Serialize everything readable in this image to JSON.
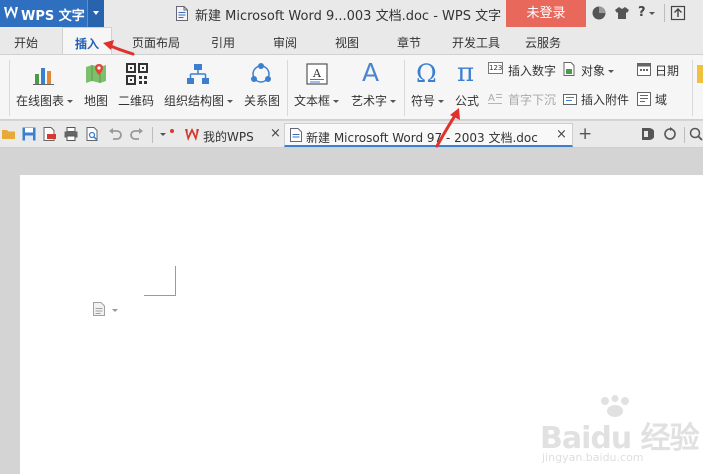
{
  "app": {
    "name": "WPS 文字",
    "window_title": "新建 Microsoft Word 9...003 文档.doc - WPS 文字",
    "login_label": "未登录",
    "help_label": "?"
  },
  "tabs": [
    {
      "label": "开始"
    },
    {
      "label": "插入"
    },
    {
      "label": "页面布局"
    },
    {
      "label": "引用"
    },
    {
      "label": "审阅"
    },
    {
      "label": "视图"
    },
    {
      "label": "章节"
    },
    {
      "label": "开发工具"
    },
    {
      "label": "云服务"
    }
  ],
  "ribbon": {
    "online_chart": "在线图表",
    "map": "地图",
    "qrcode": "二维码",
    "org_chart": "组织结构图",
    "relation_chart": "关系图",
    "textbox": "文本框",
    "wordart": "艺术字",
    "symbol": "符号",
    "formula": "公式",
    "insert_number": "插入数字",
    "drop_cap": "首字下沉",
    "object": "对象",
    "insert_attachment": "插入附件",
    "date": "日期",
    "field": "域",
    "symbol_glyph": "Ω",
    "formula_glyph": "π",
    "wordart_glyph": "A",
    "number_glyph": "123"
  },
  "doc_tabs": [
    {
      "label": "我的WPS",
      "close": "×"
    },
    {
      "label": "新建 Microsoft Word 97 - 2003 文档.doc",
      "close": "×"
    }
  ],
  "new_tab_label": "+",
  "watermark": {
    "main": "Baidu 经验",
    "sub": "jingyan.baidu.com"
  },
  "colors": {
    "app_blue": "#2f6fc0",
    "login_red": "#e8685c",
    "annotation_red": "#e0312a",
    "active_tab_text": "#1f5fb4"
  }
}
